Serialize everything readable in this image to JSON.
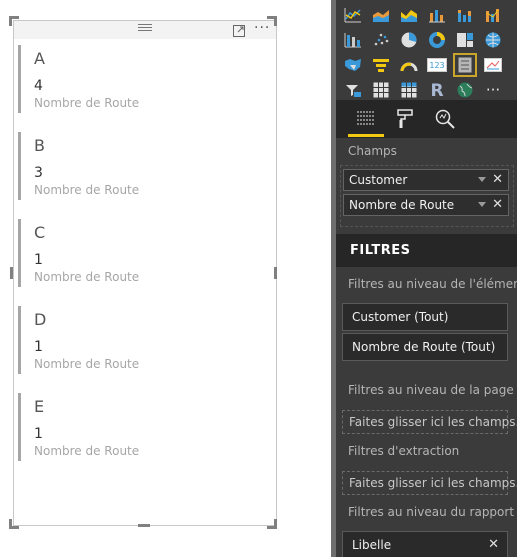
{
  "canvas": {
    "cards": [
      {
        "title": "A",
        "value": "4",
        "label": "Nombre de Route"
      },
      {
        "title": "B",
        "value": "3",
        "label": "Nombre de Route"
      },
      {
        "title": "C",
        "value": "1",
        "label": "Nombre de Route"
      },
      {
        "title": "D",
        "value": "1",
        "label": "Nombre de Route"
      },
      {
        "title": "E",
        "value": "1",
        "label": "Nombre de Route"
      }
    ],
    "more_label": "···"
  },
  "panel": {
    "viz_icons": [
      "line-chart-icon",
      "area-chart-icon",
      "stacked-area-chart-icon",
      "line-clustered-column-icon",
      "line-stacked-column-icon",
      "ribbon-chart-icon",
      "waterfall-chart-icon",
      "scatter-chart-icon",
      "pie-chart-icon",
      "donut-chart-icon",
      "treemap-icon",
      "map-icon",
      "filled-map-icon",
      "funnel-icon",
      "gauge-icon",
      "card-icon",
      "multi-row-card-icon",
      "kpi-icon",
      "slicer-icon",
      "table-icon",
      "matrix-icon",
      "r-visual-icon",
      "globe-icon",
      "more-visuals-icon"
    ],
    "tabs": [
      "fields-tab",
      "format-tab",
      "analytics-tab"
    ],
    "fields_section_label": "Champs",
    "fields": [
      "Customer",
      "Nombre de Route"
    ],
    "filters_title": "FILTRES",
    "visual_filters_label": "Filtres au niveau de l'élément...",
    "visual_filters": [
      "Customer  (Tout)",
      "Nombre de Route  (Tout)"
    ],
    "page_filters_label": "Filtres au niveau de la page",
    "page_filters_drop": "Faites glisser ici les champs...",
    "drillthrough_label": "Filtres d'extraction",
    "drillthrough_drop": "Faites glisser ici les champs...",
    "report_filters_label": "Filtres au niveau du rapport",
    "report_filters": [
      "Libelle"
    ],
    "accent_color": "#f2c811"
  }
}
